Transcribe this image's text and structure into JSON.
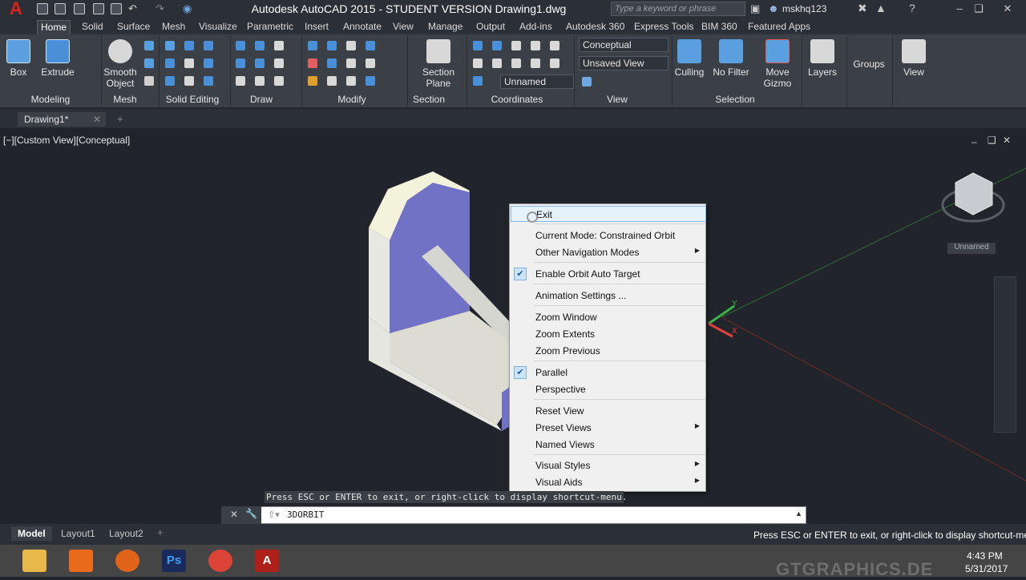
{
  "titlebar": {
    "title": "Autodesk AutoCAD 2015 - STUDENT VERSION    Drawing1.dwg",
    "search_placeholder": "Type a keyword or phrase",
    "user": "mskhq123"
  },
  "tabs": [
    "Home",
    "Solid",
    "Surface",
    "Mesh",
    "Visualize",
    "Parametric",
    "Insert",
    "Annotate",
    "View",
    "Manage",
    "Output",
    "Add-ins",
    "Autodesk 360",
    "Express Tools",
    "BIM 360",
    "Featured Apps"
  ],
  "ribbon": {
    "box": "Box",
    "extrude": "Extrude",
    "smooth_object_1": "Smooth",
    "smooth_object_2": "Object",
    "section_plane_1": "Section",
    "section_plane_2": "Plane",
    "visual_style": "Conceptual",
    "saved_view": "Unsaved View",
    "ucs_name": "Unnamed",
    "culling": "Culling",
    "no_filter": "No Filter",
    "move_gizmo_1": "Move",
    "move_gizmo_2": "Gizmo",
    "layers": "Layers",
    "groups": "Groups",
    "view": "View",
    "panels": {
      "modeling": "Modeling",
      "mesh": "Mesh",
      "solid_editing": "Solid Editing",
      "draw": "Draw",
      "modify": "Modify",
      "section": "Section",
      "coordinates": "Coordinates",
      "view": "View",
      "selection": "Selection"
    }
  },
  "file_tab": "Drawing1*",
  "viewport": {
    "label": "[−][Custom View][Conceptual]",
    "viewcube_name": "Unnamed"
  },
  "context_menu": {
    "items": [
      {
        "label": "Exit",
        "checked": false,
        "submenu": false
      },
      {
        "label": "Current Mode: Constrained Orbit",
        "checked": false,
        "submenu": false
      },
      {
        "label": "Other Navigation Modes",
        "checked": false,
        "submenu": true
      },
      {
        "label": "Enable Orbit Auto Target",
        "checked": true,
        "submenu": false
      },
      {
        "label": "Animation Settings ...",
        "checked": false,
        "submenu": false
      },
      {
        "label": "Zoom Window",
        "checked": false,
        "submenu": false
      },
      {
        "label": "Zoom Extents",
        "checked": false,
        "submenu": false
      },
      {
        "label": "Zoom Previous",
        "checked": false,
        "submenu": false
      },
      {
        "label": "Parallel",
        "checked": true,
        "submenu": false
      },
      {
        "label": "Perspective",
        "checked": false,
        "submenu": false
      },
      {
        "label": "Reset View",
        "checked": false,
        "submenu": false
      },
      {
        "label": "Preset Views",
        "checked": false,
        "submenu": true
      },
      {
        "label": "Named Views",
        "checked": false,
        "submenu": false
      },
      {
        "label": "Visual Styles",
        "checked": false,
        "submenu": true
      },
      {
        "label": "Visual Aids",
        "checked": false,
        "submenu": true
      }
    ]
  },
  "command": {
    "history": "Press ESC or ENTER to exit, or right-click to display shortcut-menu.",
    "input": "3DORBIT"
  },
  "layout_tabs": [
    "Model",
    "Layout1",
    "Layout2"
  ],
  "status_message": "Press ESC or ENTER to exit, or right-click to display shortcut-menu.",
  "taskbar": {
    "time": "4:43 PM",
    "date": "5/31/2017",
    "watermark": "GTGRAPHICS.DE"
  },
  "colors": {
    "accent_red": "#e0221b",
    "face_blue": "#7171c6",
    "face_light": "#f3f3dc",
    "menu_bg": "#f0f0f0"
  }
}
